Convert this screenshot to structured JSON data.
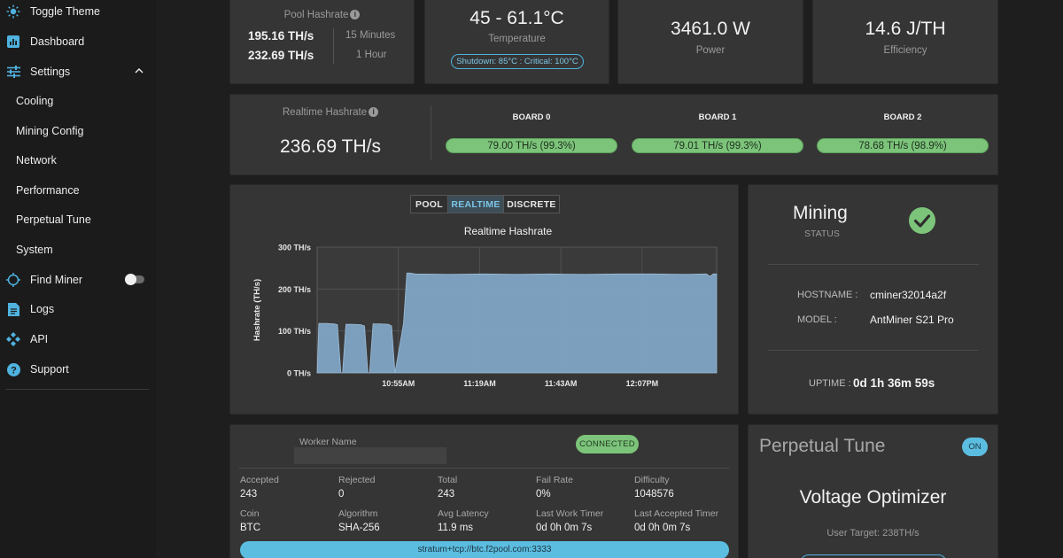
{
  "sidebar": {
    "items": [
      {
        "label": "Toggle Theme",
        "icon": "sun-icon"
      },
      {
        "label": "Dashboard",
        "icon": "chart-icon"
      },
      {
        "label": "Settings",
        "icon": "sliders-icon"
      },
      {
        "label": "Cooling"
      },
      {
        "label": "Mining Config"
      },
      {
        "label": "Network"
      },
      {
        "label": "Performance"
      },
      {
        "label": "Perpetual Tune"
      },
      {
        "label": "System"
      },
      {
        "label": "Find Miner",
        "icon": "crosshair-icon"
      },
      {
        "label": "Logs",
        "icon": "document-icon"
      },
      {
        "label": "API",
        "icon": "api-icon"
      },
      {
        "label": "Support",
        "icon": "help-icon"
      }
    ],
    "find_miner_toggle": false
  },
  "pool_hashrate": {
    "title": "Pool Hashrate",
    "value_15m": "195.16 TH/s",
    "value_1h": "232.69 TH/s",
    "label_15m": "15 Minutes",
    "label_1h": "1 Hour"
  },
  "temperature": {
    "value": "45 - 61.1°C",
    "label": "Temperature",
    "badge": "Shutdown: 85°C : Critical: 100°C"
  },
  "power": {
    "value": "3461.0 W",
    "label": "Power"
  },
  "efficiency": {
    "value": "14.6 J/TH",
    "label": "Efficiency"
  },
  "realtime": {
    "title": "Realtime Hashrate",
    "value": "236.69 TH/s",
    "boards": [
      {
        "name": "BOARD 0",
        "value": "79.00 TH/s (99.3%)"
      },
      {
        "name": "BOARD 1",
        "value": "79.01 TH/s (99.3%)"
      },
      {
        "name": "BOARD 2",
        "value": "78.68 TH/s (98.9%)"
      }
    ]
  },
  "chart_tabs": {
    "pool": "POOL",
    "realtime": "REALTIME",
    "discrete": "DISCRETE",
    "active": "REALTIME"
  },
  "chart_data": {
    "type": "area",
    "title": "Realtime Hashrate",
    "ylabel": "Hashrate (TH/s)",
    "xlabel": "",
    "ylim": [
      0,
      300
    ],
    "yticks": [
      "0 TH/s",
      "100 TH/s",
      "200 TH/s",
      "300 TH/s"
    ],
    "yticks_values": [
      0,
      100,
      200,
      300
    ],
    "xticks": [
      "10:55AM",
      "11:19AM",
      "11:43AM",
      "12:07PM"
    ],
    "xticks_minutes": [
      55,
      79,
      103,
      127
    ],
    "xlim_minutes": [
      31,
      149
    ],
    "x_minutes": [
      31,
      31.5,
      33.5,
      36,
      37,
      38,
      38.5,
      39.5,
      41.5,
      44,
      45,
      46,
      46.5,
      47.5,
      49.5,
      52,
      53,
      54,
      56.5,
      57.5,
      58.5,
      60,
      70,
      80,
      90,
      100,
      110,
      120,
      130,
      140,
      146,
      147,
      148,
      149
    ],
    "values": [
      0,
      118,
      118,
      117,
      115,
      0,
      0,
      116,
      116,
      115,
      112,
      0,
      0,
      117,
      117,
      116,
      112,
      0,
      118,
      238,
      238,
      236,
      235,
      236,
      235,
      236,
      235,
      236,
      236,
      235,
      236,
      230,
      236,
      236
    ],
    "color": "#7ea4c4",
    "grid": true
  },
  "status": {
    "title": "Mining",
    "subtitle": "STATUS",
    "hostname_label": "HOSTNAME :",
    "hostname": "cminer32014a2f",
    "model_label": "MODEL :",
    "model": "AntMiner S21 Pro",
    "uptime_label": "UPTIME :",
    "uptime": "0d 1h 36m 59s",
    "status_color": "#7cc47a"
  },
  "pool": {
    "worker_label": "Worker Name",
    "worker_value": "",
    "connection": "CONNECTED",
    "stats": [
      {
        "label": "Accepted",
        "value": "243"
      },
      {
        "label": "Rejected",
        "value": "0"
      },
      {
        "label": "Total",
        "value": "243"
      },
      {
        "label": "Fail Rate",
        "value": "0%"
      },
      {
        "label": "Difficulty",
        "value": "1048576"
      },
      {
        "label": "Coin",
        "value": "BTC"
      },
      {
        "label": "Algorithm",
        "value": "SHA-256"
      },
      {
        "label": "Avg Latency",
        "value": "11.9 ms"
      },
      {
        "label": "Last Work Timer",
        "value": "0d 0h 0m 7s"
      },
      {
        "label": "Last Accepted Timer",
        "value": "0d 0h 0m 7s"
      }
    ],
    "url": "stratum+tcp://btc.f2pool.com:3333"
  },
  "perpetual_tune": {
    "title": "Perpetual Tune",
    "toggle": "ON",
    "mode": "Voltage Optimizer",
    "target": "User Target: 238TH/s"
  }
}
